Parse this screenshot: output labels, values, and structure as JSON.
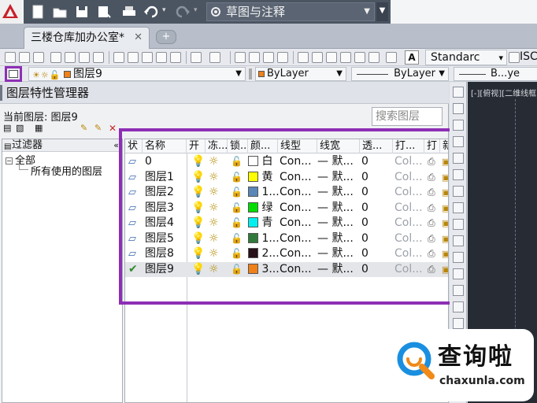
{
  "colors": {
    "accent": "#8d2fb5",
    "titlebar": "#4b5562",
    "drawing_bg": "#262b34"
  },
  "quick_access": {
    "workspace": "草图与注释",
    "icons": [
      "new-icon",
      "open-icon",
      "save-icon",
      "save-as-icon",
      "plot-icon",
      "undo-icon",
      "redo-icon"
    ]
  },
  "document_tab": {
    "title": "三楼仓库加办公室*",
    "close": "✕",
    "new_tab": "+"
  },
  "toolbar_row1": {
    "text_style": "Standarc",
    "dim_style": "ISC"
  },
  "toolbar_row2": {
    "current_layer": "图层9",
    "color": "ByLayer",
    "linetype": "ByLayer",
    "lineweight": "B...ye"
  },
  "palette": {
    "title": "图层特性管理器",
    "current_layer_label": "当前图层: 图层9",
    "search_placeholder": "搜索图层",
    "filter_header": "过滤器",
    "tree": {
      "root": "全部",
      "child": "所有使用的图层"
    },
    "columns": [
      "状",
      "名称",
      "开",
      "冻...",
      "锁...",
      "颜...",
      "线型",
      "线宽",
      "透...",
      "打...",
      "打",
      "新"
    ],
    "layers": [
      {
        "name": "0",
        "color_label": "白",
        "color_hex": "#ffffff",
        "linetype": "Con...",
        "lineweight": "默...",
        "transparency": "0",
        "plot_style": "Col...",
        "current": false
      },
      {
        "name": "图层1",
        "color_label": "黄",
        "color_hex": "#ffff00",
        "linetype": "Con...",
        "lineweight": "默...",
        "transparency": "0",
        "plot_style": "Col...",
        "current": false
      },
      {
        "name": "图层2",
        "color_label": "1...",
        "color_hex": "#5a86b8",
        "linetype": "Con...",
        "lineweight": "默...",
        "transparency": "0",
        "plot_style": "Col...",
        "current": false
      },
      {
        "name": "图层3",
        "color_label": "绿",
        "color_hex": "#00dd00",
        "linetype": "Con...",
        "lineweight": "默...",
        "transparency": "0",
        "plot_style": "Col...",
        "current": false
      },
      {
        "name": "图层4",
        "color_label": "青",
        "color_hex": "#00f0f0",
        "linetype": "Con...",
        "lineweight": "默...",
        "transparency": "0",
        "plot_style": "Col...",
        "current": false
      },
      {
        "name": "图层5",
        "color_label": "1...",
        "color_hex": "#2f7a3a",
        "linetype": "Con...",
        "lineweight": "默...",
        "transparency": "0",
        "plot_style": "Col...",
        "current": false
      },
      {
        "name": "图层8",
        "color_label": "2...",
        "color_hex": "#2a1018",
        "linetype": "Con...",
        "lineweight": "默...",
        "transparency": "0",
        "plot_style": "Col...",
        "current": false
      },
      {
        "name": "图层9",
        "color_label": "3...",
        "color_hex": "#f08018",
        "linetype": "Con...",
        "lineweight": "默...",
        "transparency": "0",
        "plot_style": "Col...",
        "current": true
      }
    ]
  },
  "viewport_label": "[-][俯视][二维线框]",
  "watermark": {
    "brand": "查询啦",
    "url": "chaxunla.com"
  }
}
